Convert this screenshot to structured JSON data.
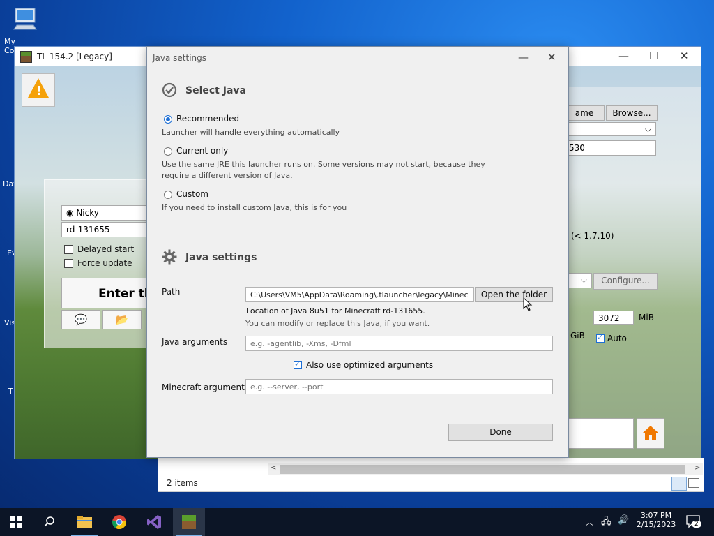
{
  "desktop": {
    "icons": [
      "My Computer"
    ],
    "side_labels": [
      "Dat",
      "Ev",
      "Vis",
      "T"
    ]
  },
  "launcher": {
    "title": "TL 154.2 [Legacy]",
    "username": "Nicky",
    "version": "rd-131655",
    "delayed_start_label": "Delayed start",
    "force_update_label": "Force update",
    "enter_label": "Enter the",
    "right": {
      "name_btn": "ame",
      "browse_btn": "Browse...",
      "res_value": "530",
      "note": "(< 1.7.10)",
      "configure_btn": "Configure...",
      "memory_value": "3072",
      "memory_unit": "MiB",
      "gib_label": "GiB",
      "auto_label": "Auto"
    }
  },
  "explorer": {
    "status": "2 items"
  },
  "dialog": {
    "title": "Java settings",
    "select_java": {
      "heading": "Select Java",
      "recommended_label": "Recommended",
      "recommended_desc": "Launcher will handle everything automatically",
      "current_label": "Current only",
      "current_desc_1": "Use the same JRE this launcher runs on. Some versions may not start, because they",
      "current_desc_2": "require a different version of Java.",
      "custom_label": "Custom",
      "custom_desc": "If you need to install custom Java, this is for you"
    },
    "java_settings": {
      "heading": "Java settings",
      "path_label": "Path",
      "path_value": "C:\\Users\\VM5\\AppData\\Roaming\\.tlauncher\\legacy\\Minec",
      "open_folder_btn": "Open the folder",
      "location_note": "Location of Java 8u51 for Minecraft rd-131655.",
      "modify_link": "You can modify or replace this Java, if you want.",
      "java_args_label": "Java arguments",
      "java_args_placeholder": "e.g. -agentlib, -Xms, -Dfml",
      "optimized_label": "Also use optimized arguments",
      "mc_args_label": "Minecraft arguments",
      "mc_args_placeholder": "e.g. --server, --port"
    },
    "done_btn": "Done"
  },
  "taskbar": {
    "time": "3:07 PM",
    "date": "2/15/2023",
    "notifications": "2"
  }
}
